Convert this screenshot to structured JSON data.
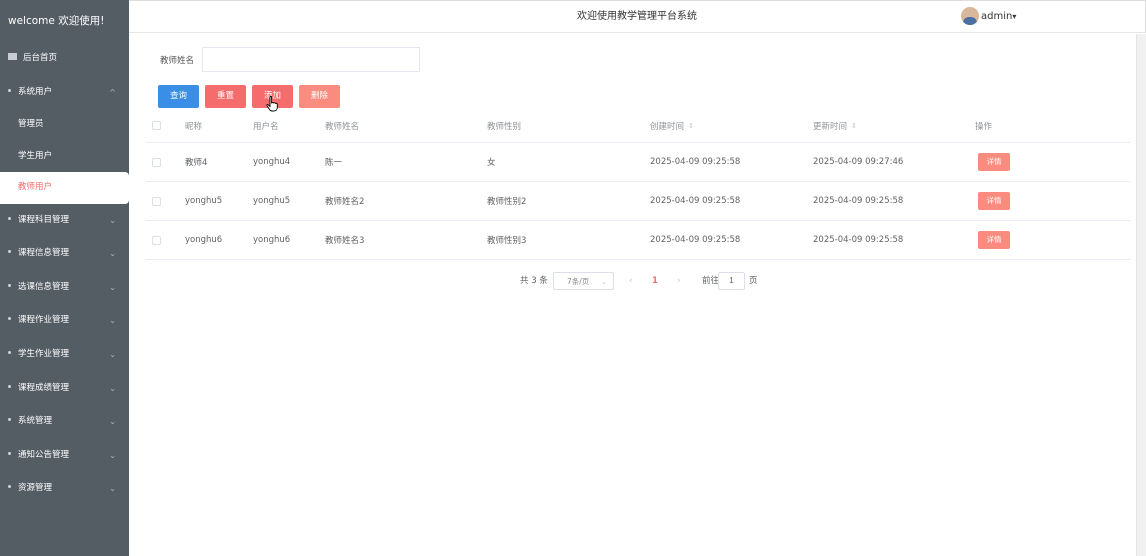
{
  "sidebar": {
    "brand": "welcome 欢迎使用!",
    "home": "后台首页",
    "groups": [
      {
        "label": "系统用户",
        "chev": "^",
        "children": [
          "管理员",
          "学生用户",
          "教师用户"
        ]
      },
      {
        "label": "课程科目管理",
        "chev": "⌄"
      },
      {
        "label": "课程信息管理",
        "chev": "⌄"
      },
      {
        "label": "选课信息管理",
        "chev": "⌄"
      },
      {
        "label": "课程作业管理",
        "chev": "⌄"
      },
      {
        "label": "学生作业管理",
        "chev": "⌄"
      },
      {
        "label": "课程成绩管理",
        "chev": "⌄"
      },
      {
        "label": "系统管理",
        "chev": "⌄"
      },
      {
        "label": "通知公告管理",
        "chev": "⌄"
      },
      {
        "label": "资源管理",
        "chev": "⌄"
      }
    ]
  },
  "header": {
    "title": "欢迎使用教学管理平台系统",
    "user": "admin",
    "user_caret": "▾"
  },
  "search": {
    "label": "教师姓名",
    "value": ""
  },
  "buttons": {
    "query": "查询",
    "reset": "重置",
    "add": "添加",
    "delete": "删除"
  },
  "table": {
    "headers": [
      "昵称",
      "用户名",
      "教师姓名",
      "教师性别",
      "创建时间",
      "更新时间",
      "操作"
    ],
    "sort_glyph": "⇕",
    "rows": [
      {
        "nickname": "教师4",
        "username": "yonghu4",
        "name": "陈一",
        "gender": "女",
        "created": "2025-04-09 09:25:58",
        "updated": "2025-04-09 09:27:46",
        "action": "详情"
      },
      {
        "nickname": "yonghu5",
        "username": "yonghu5",
        "name": "教师姓名2",
        "gender": "教师性别2",
        "created": "2025-04-09 09:25:58",
        "updated": "2025-04-09 09:25:58",
        "action": "详情"
      },
      {
        "nickname": "yonghu6",
        "username": "yonghu6",
        "name": "教师姓名3",
        "gender": "教师性别3",
        "created": "2025-04-09 09:25:58",
        "updated": "2025-04-09 09:25:58",
        "action": "详情"
      }
    ]
  },
  "pagination": {
    "total": "共 3 条",
    "page_size": "7条/页",
    "caret": "⌄",
    "prev": "‹",
    "current": "1",
    "next": "›",
    "goto": "前往",
    "goto_value": "1",
    "suffix": "页"
  },
  "colors": {
    "sidebar_bg": "#545c64",
    "primary": "#3a8ee6",
    "danger": "#f56c6c"
  }
}
